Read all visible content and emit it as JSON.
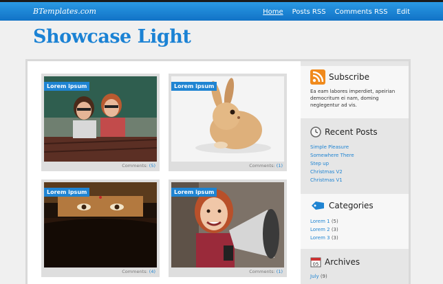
{
  "header": {
    "brand": "BTemplates.com",
    "nav": [
      "Home",
      "Posts RSS",
      "Comments RSS",
      "Edit"
    ],
    "site_title": "Showcase Light"
  },
  "posts": [
    {
      "tag": "Lorem ipsum",
      "comments_label": "Comments:",
      "count": "(5)"
    },
    {
      "tag": "Lorem ipsum",
      "comments_label": "Comments:",
      "count": "(1)"
    },
    {
      "tag": "Lorem ipsum",
      "comments_label": "Comments:",
      "count": "(4)"
    },
    {
      "tag": "Lorem ipsum",
      "comments_label": "Comments:",
      "count": "(1)"
    }
  ],
  "sidebar": {
    "subscribe": {
      "title": "Subscribe",
      "text": "Ea eam labores imperdiet, apeirian democritum ei nam, doming neglegentur ad vis.",
      "icon": "rss-icon"
    },
    "recent": {
      "title": "Recent Posts",
      "icon": "clock-icon",
      "items": [
        "Simple Pleasure",
        "Somewhere There",
        "Step up",
        "Christmas V2",
        "Christmas V1"
      ]
    },
    "categories": {
      "title": "Categories",
      "icon": "tag-icon",
      "items": [
        {
          "label": "Lorem 1",
          "count": "(5)"
        },
        {
          "label": "Lorem 2",
          "count": "(3)"
        },
        {
          "label": "Lorem 3",
          "count": "(3)"
        }
      ]
    },
    "archives": {
      "title": "Archives",
      "icon": "calendar-icon",
      "items": [
        {
          "label": "July",
          "count": "(9)"
        }
      ]
    }
  },
  "colors": {
    "accent": "#1f84d2",
    "topbar": "#1172c6",
    "title": "#1b82d4"
  }
}
